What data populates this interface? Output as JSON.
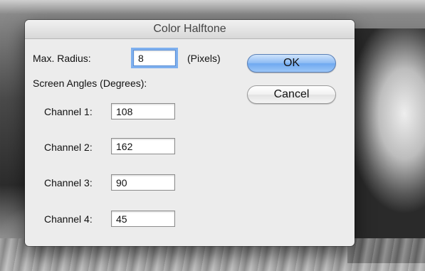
{
  "dialog": {
    "title": "Color Halftone",
    "max_radius_label": "Max. Radius:",
    "max_radius_value": "8",
    "units_label": "(Pixels)",
    "screen_angles_label": "Screen Angles (Degrees):",
    "channels": [
      {
        "label": "Channel 1:",
        "value": "108"
      },
      {
        "label": "Channel 2:",
        "value": "162"
      },
      {
        "label": "Channel 3:",
        "value": "90"
      },
      {
        "label": "Channel 4:",
        "value": "45"
      }
    ],
    "ok_label": "OK",
    "cancel_label": "Cancel"
  },
  "colors": {
    "dialog_bg": "#ececec",
    "focus_ring": "#7fb0ee",
    "default_button": "#8fbcf4"
  }
}
